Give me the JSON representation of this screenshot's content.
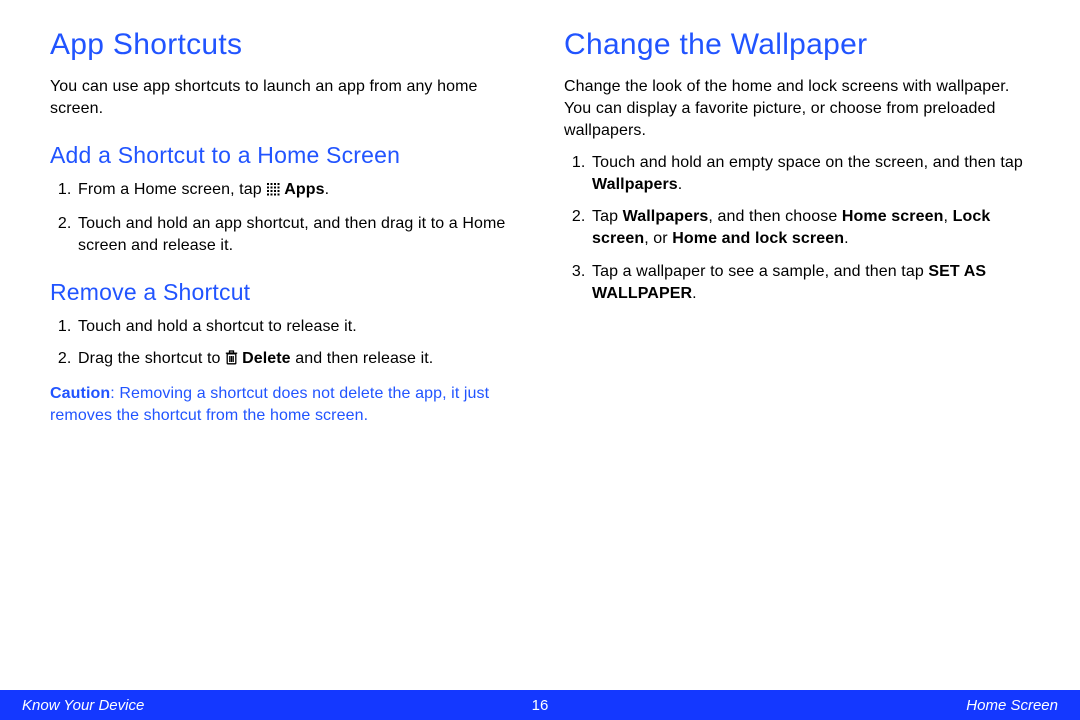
{
  "left": {
    "h1": "App Shortcuts",
    "intro": "You can use app shortcuts to launch an app from any home screen.",
    "sec1_title": "Add a Shortcut to a Home Screen",
    "sec1_step1_a": "From a Home screen, tap ",
    "sec1_step1_b": "Apps",
    "sec1_step1_c": ".",
    "sec1_step2": "Touch and hold an app shortcut, and then drag it to a Home screen and release it.",
    "sec2_title": "Remove a Shortcut",
    "sec2_step1": "Touch and hold a shortcut to release it.",
    "sec2_step2_a": "Drag the shortcut to ",
    "sec2_step2_b": "Delete",
    "sec2_step2_c": " and then release it.",
    "caution_label": "Caution",
    "caution_body": ": Removing a shortcut does not delete the app, it just removes the shortcut from the home screen."
  },
  "right": {
    "h1": "Change the Wallpaper",
    "intro": "Change the look of the home and lock screens with wallpaper. You can display a favorite picture, or choose from preloaded wallpapers.",
    "step1_a": "Touch and hold an empty space on the screen, and then tap ",
    "step1_b": "Wallpapers",
    "step1_c": ".",
    "step2_a": "Tap ",
    "step2_b": "Wallpapers",
    "step2_c": ", and then choose ",
    "step2_d": "Home screen",
    "step2_e": ", ",
    "step2_f": "Lock screen",
    "step2_g": ", or ",
    "step2_h": "Home and lock screen",
    "step2_i": ".",
    "step3_a": "Tap a wallpaper to see a sample, and then tap ",
    "step3_b": "SET AS WALLPAPER",
    "step3_c": "."
  },
  "footer": {
    "left": "Know Your Device",
    "center": "16",
    "right": "Home Screen"
  }
}
